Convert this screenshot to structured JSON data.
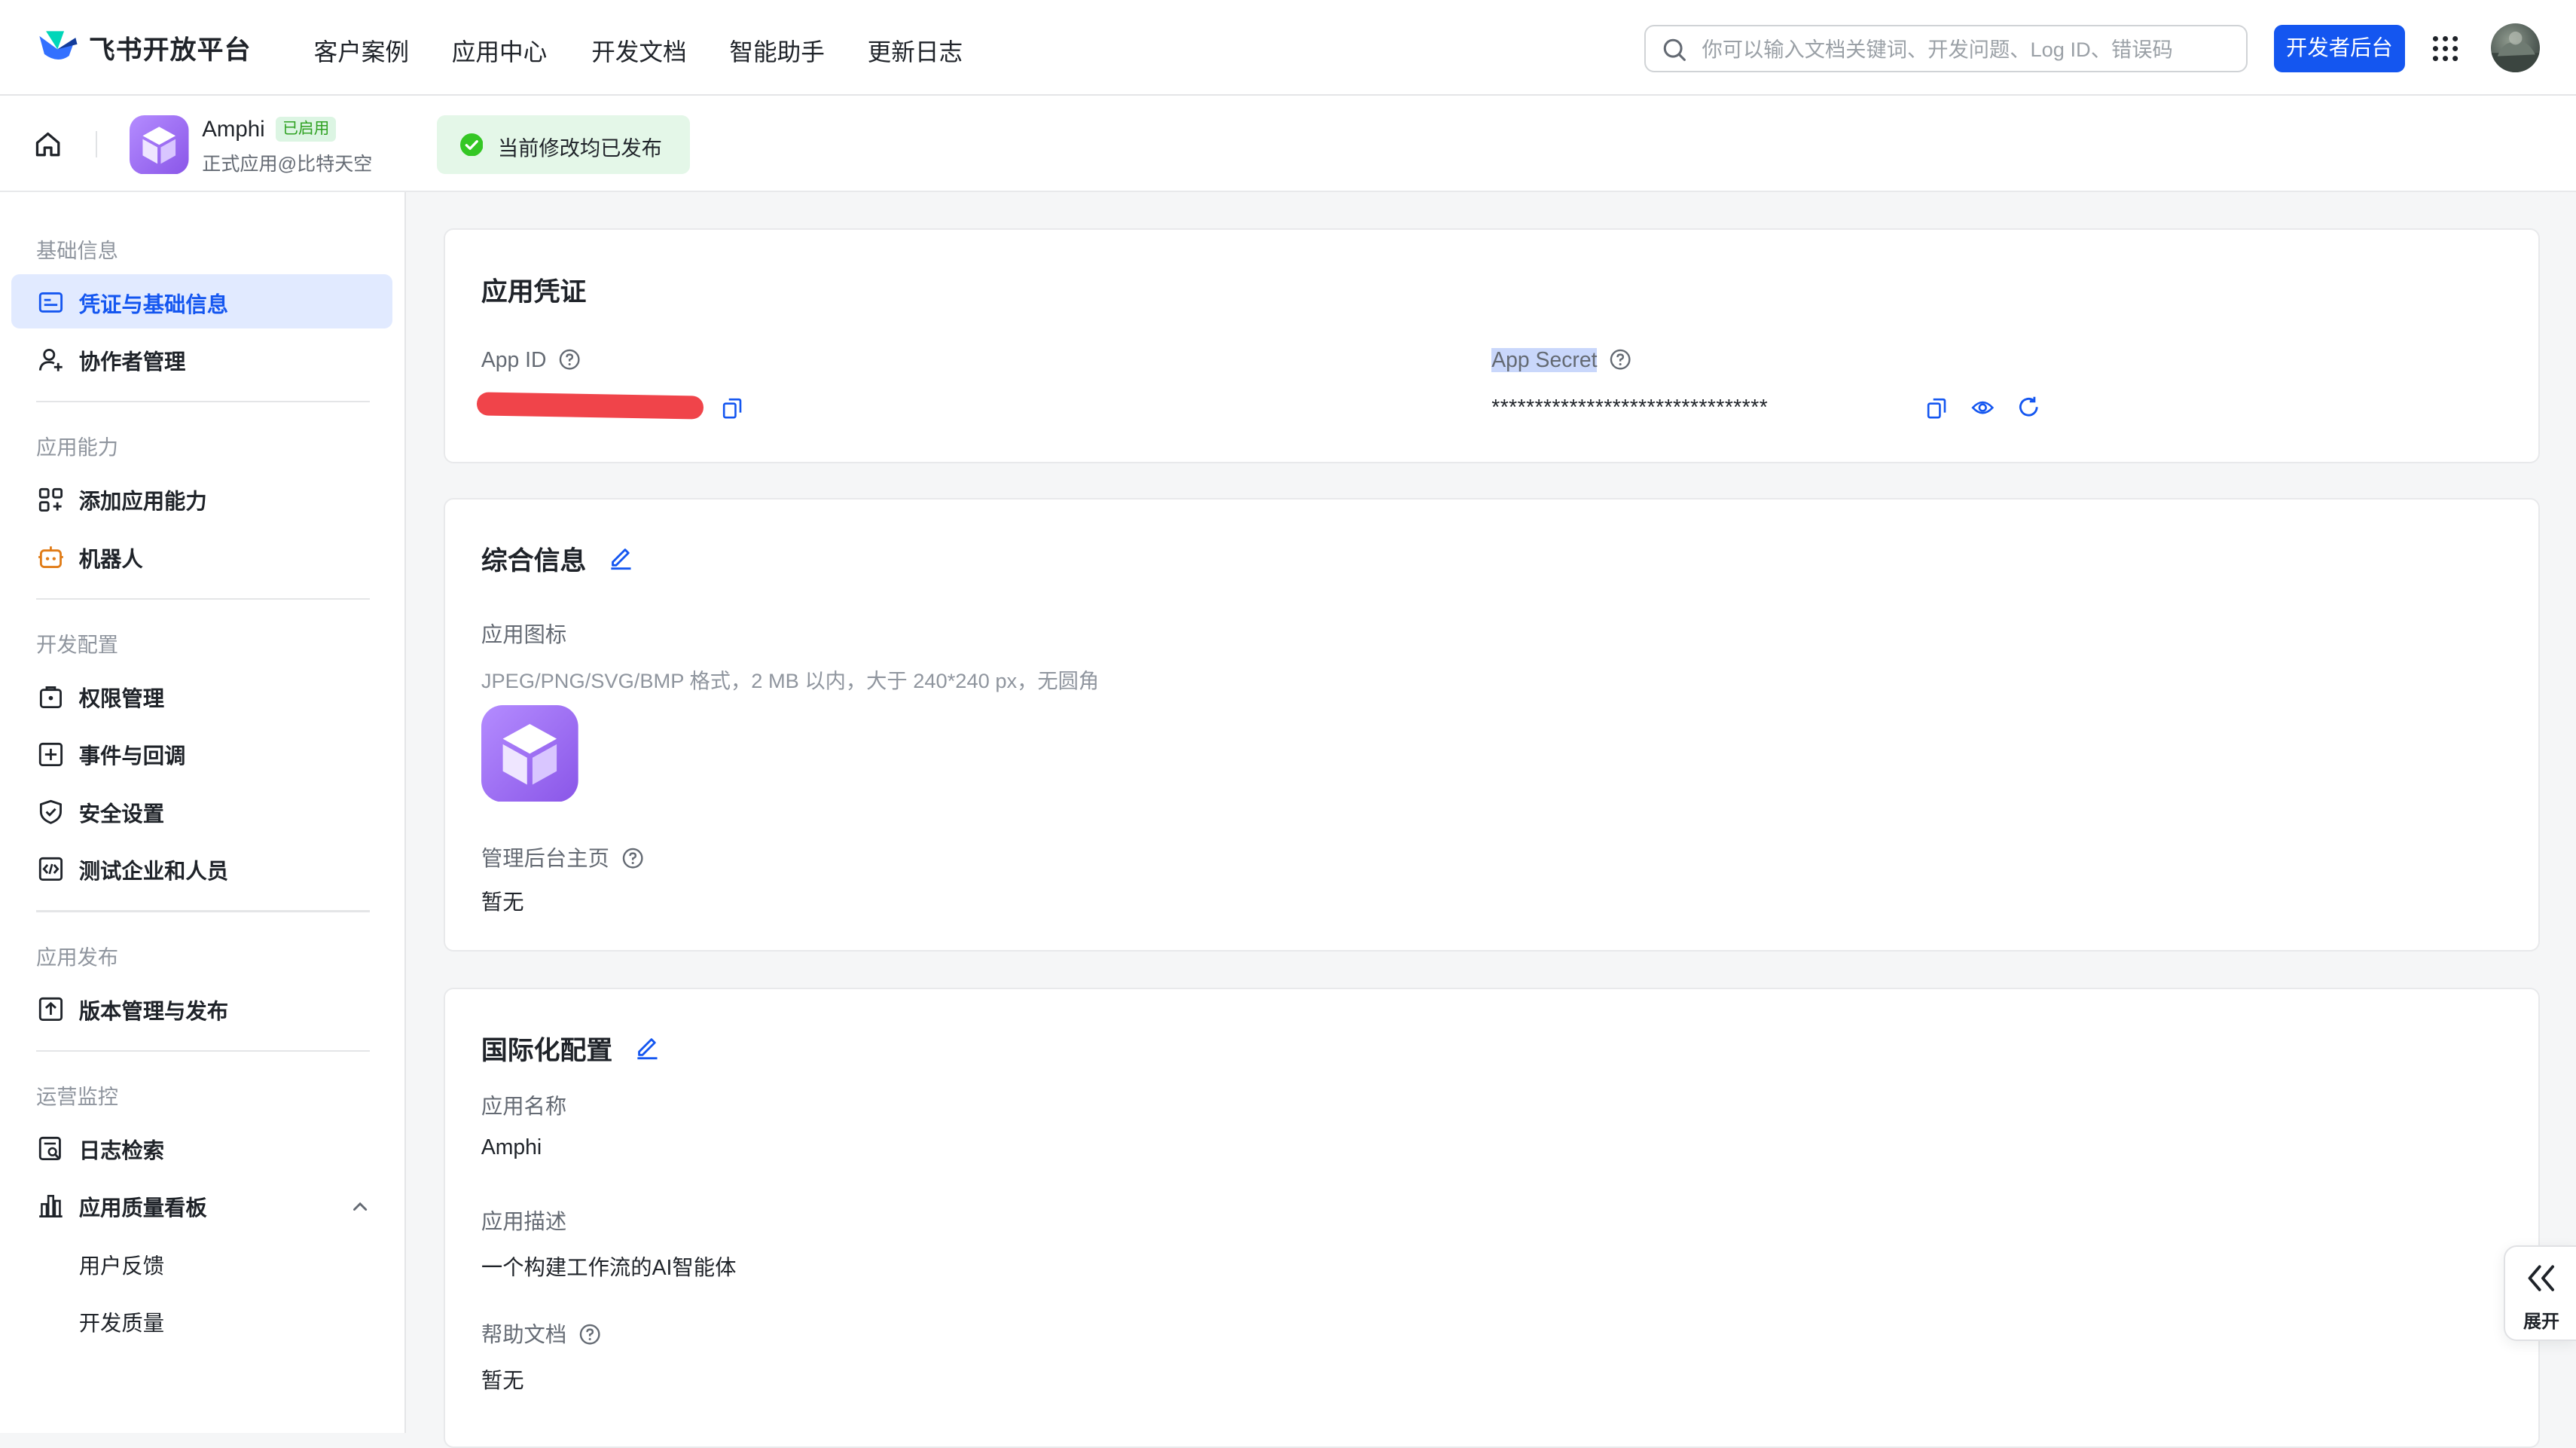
{
  "nav": {
    "brand": "飞书开放平台",
    "links": [
      "客户案例",
      "应用中心",
      "开发文档",
      "智能助手",
      "更新日志"
    ],
    "search_placeholder": "你可以输入文档关键词、开发问题、Log ID、错误码",
    "dev_console_button": "开发者后台"
  },
  "appbar": {
    "app_name": "Amphi",
    "status_badge": "已启用",
    "app_subtitle": "正式应用@比特天空",
    "publish_status": "当前修改均已发布"
  },
  "sidebar": {
    "sections": [
      {
        "title": "基础信息",
        "items": [
          {
            "label": "凭证与基础信息",
            "icon": "id-card-icon",
            "active": true
          },
          {
            "label": "协作者管理",
            "icon": "user-plus-icon"
          }
        ]
      },
      {
        "title": "应用能力",
        "items": [
          {
            "label": "添加应用能力",
            "icon": "apps-add-icon"
          },
          {
            "label": "机器人",
            "icon": "robot-icon"
          }
        ]
      },
      {
        "title": "开发配置",
        "items": [
          {
            "label": "权限管理",
            "icon": "lock-icon"
          },
          {
            "label": "事件与回调",
            "icon": "event-icon"
          },
          {
            "label": "安全设置",
            "icon": "shield-icon"
          },
          {
            "label": "测试企业和人员",
            "icon": "code-icon"
          }
        ]
      },
      {
        "title": "应用发布",
        "items": [
          {
            "label": "版本管理与发布",
            "icon": "upload-icon"
          }
        ]
      },
      {
        "title": "运营监控",
        "items": [
          {
            "label": "日志检索",
            "icon": "log-search-icon"
          },
          {
            "label": "应用质量看板",
            "icon": "bar-chart-icon",
            "expanded": true
          },
          {
            "label": "用户反馈",
            "sub": true
          },
          {
            "label": "开发质量",
            "sub": true
          }
        ]
      }
    ]
  },
  "credentials": {
    "title": "应用凭证",
    "app_id_label": "App ID",
    "app_secret_label": "App Secret",
    "app_secret_value": "********************************"
  },
  "general": {
    "title": "综合信息",
    "icon_label": "应用图标",
    "icon_hint": "JPEG/PNG/SVG/BMP 格式，2 MB 以内，大于 240*240 px，无圆角",
    "admin_home_label": "管理后台主页",
    "admin_home_value": "暂无"
  },
  "i18n": {
    "title": "国际化配置",
    "name_label": "应用名称",
    "name_value": "Amphi",
    "desc_label": "应用描述",
    "desc_value": "一个构建工作流的AI智能体",
    "help_label": "帮助文档",
    "help_value": "暂无"
  },
  "expand_label": "展开",
  "colors": {
    "accent": "#1456f0",
    "active_bg": "#e1eaff",
    "success": "#2ea121",
    "app_icon": "#9b6cf2"
  }
}
